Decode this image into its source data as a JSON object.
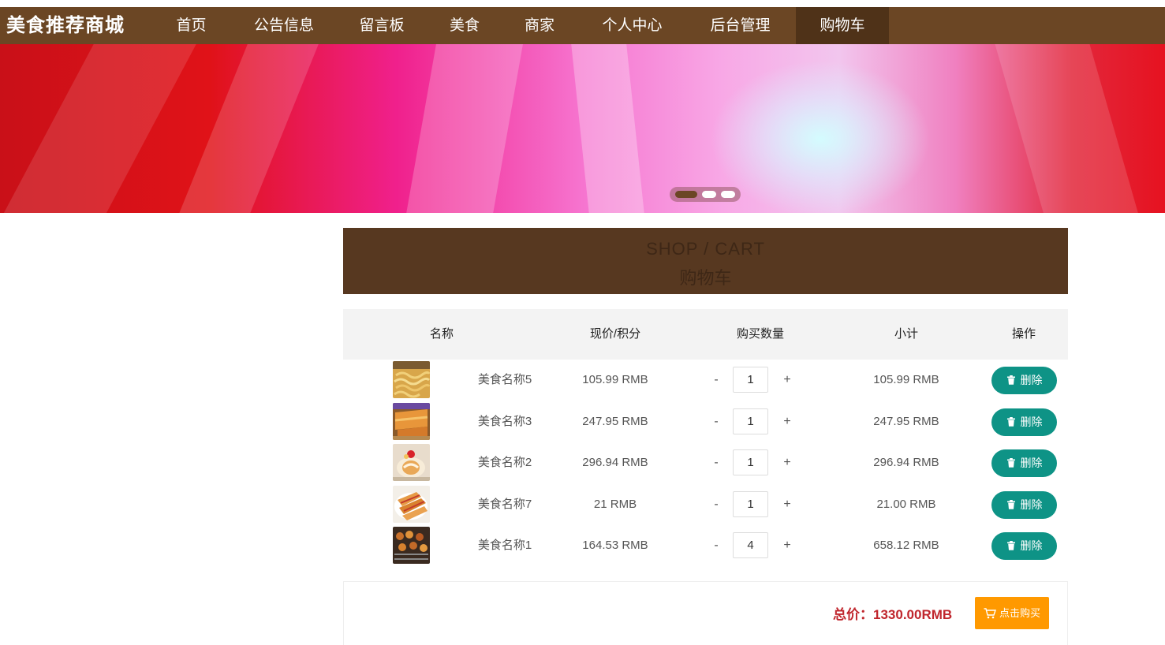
{
  "nav": {
    "brand": "美食推荐商城",
    "items": [
      {
        "label": "首页"
      },
      {
        "label": "公告信息"
      },
      {
        "label": "留言板"
      },
      {
        "label": "美食"
      },
      {
        "label": "商家"
      },
      {
        "label": "个人中心"
      },
      {
        "label": "后台管理"
      },
      {
        "label": "购物车"
      }
    ],
    "active_item": "购物车",
    "bar_color": "#6b4624"
  },
  "banner": {
    "slide_count": 3,
    "active_slide": 1
  },
  "section": {
    "title_en": "SHOP / CART",
    "title_cn": "购物车"
  },
  "table": {
    "headers": [
      "名称",
      "现价/积分",
      "购买数量",
      "小计",
      "操作"
    ],
    "minus_label": "-",
    "plus_label": "+",
    "delete_label": "删除",
    "rows": [
      {
        "name": "美食名称5",
        "price": "105.99 RMB",
        "qty": "1",
        "subtotal": "105.99 RMB",
        "thumb": "noodles"
      },
      {
        "name": "美食名称3",
        "price": "247.95 RMB",
        "qty": "1",
        "subtotal": "247.95 RMB",
        "thumb": "pastry"
      },
      {
        "name": "美食名称2",
        "price": "296.94 RMB",
        "qty": "1",
        "subtotal": "296.94 RMB",
        "thumb": "cake-roll"
      },
      {
        "name": "美食名称7",
        "price": "21 RMB",
        "qty": "1",
        "subtotal": "21.00 RMB",
        "thumb": "dumplings"
      },
      {
        "name": "美食名称1",
        "price": "164.53 RMB",
        "qty": "4",
        "subtotal": "658.12 RMB",
        "thumb": "skewers"
      }
    ]
  },
  "footer": {
    "total_label": "总价：1330.00RMB",
    "buy_label": "点击购买"
  },
  "colors": {
    "delete_button": "#0e9386",
    "buy_button": "#ff9900",
    "total_text": "#c0262d",
    "section_title_bg": "#573820"
  },
  "icons": {
    "delete": "trash-icon",
    "buy": "cart-icon"
  }
}
